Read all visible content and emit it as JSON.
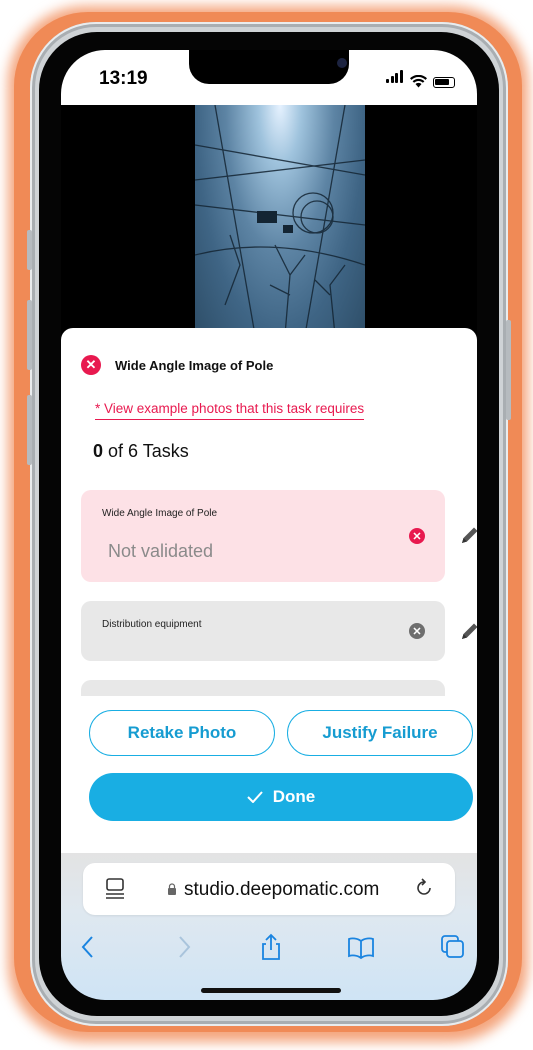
{
  "status_bar": {
    "time": "13:19"
  },
  "sheet": {
    "title": "Wide Angle Image of Pole",
    "example_link": "* View example photos that this task requires",
    "task_progress": {
      "done": "0",
      "rest": " of 6 Tasks"
    },
    "tasks": [
      {
        "label": "Wide Angle Image of Pole",
        "status": "Not validated"
      },
      {
        "label": "Distribution equipment",
        "status": ""
      }
    ],
    "buttons": {
      "retake": "Retake Photo",
      "justify": "Justify Failure",
      "done": "Done"
    }
  },
  "browser": {
    "url": "studio.deepomatic.com"
  },
  "colors": {
    "accent": "#19aee3",
    "error": "#e8194f",
    "frame_glow": "#f08a56"
  },
  "icons": [
    "close-icon",
    "pencil-icon",
    "check-icon",
    "lock-icon",
    "reload-icon",
    "back-icon",
    "forward-icon",
    "share-icon",
    "bookmarks-icon",
    "tabs-icon"
  ]
}
